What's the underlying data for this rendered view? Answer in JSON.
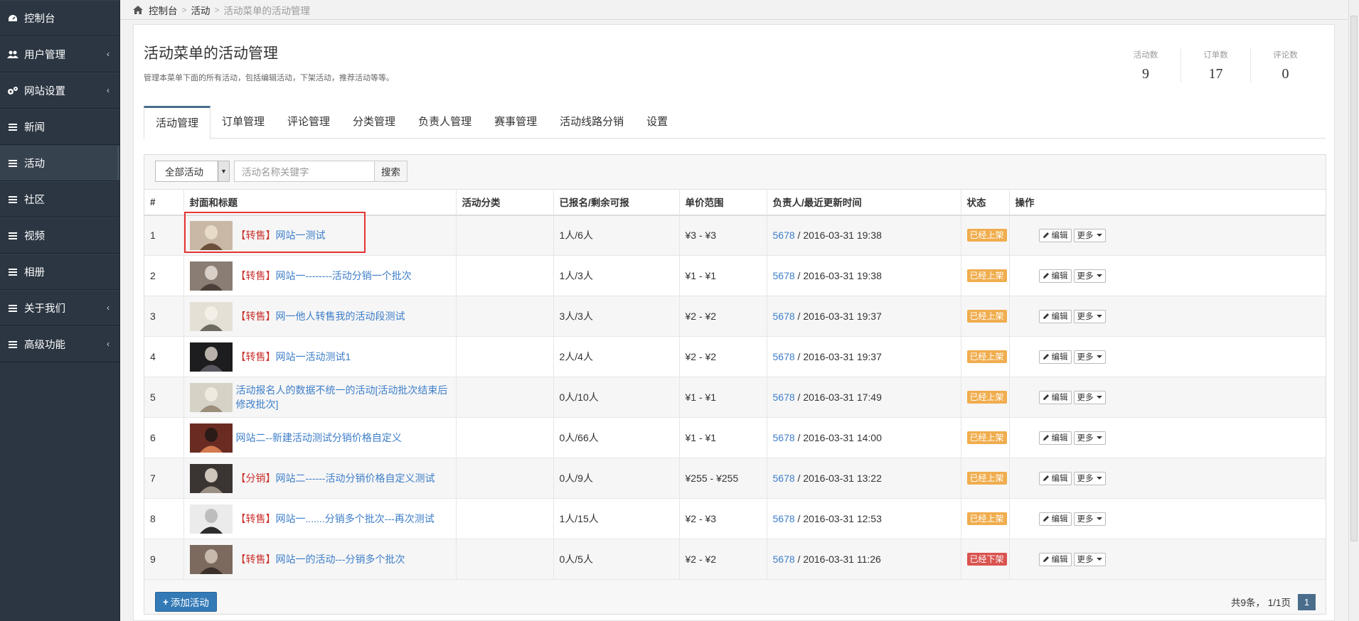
{
  "sidebar": {
    "items": [
      {
        "label": "控制台",
        "icon": "dashboard-icon",
        "has_children": false,
        "active": false
      },
      {
        "label": "用户管理",
        "icon": "users-icon",
        "has_children": true,
        "active": false
      },
      {
        "label": "网站设置",
        "icon": "cogs-icon",
        "has_children": true,
        "active": false
      },
      {
        "label": "新闻",
        "icon": "menu-icon",
        "has_children": false,
        "active": false
      },
      {
        "label": "活动",
        "icon": "menu-icon",
        "has_children": false,
        "active": true
      },
      {
        "label": "社区",
        "icon": "menu-icon",
        "has_children": false,
        "active": false
      },
      {
        "label": "视频",
        "icon": "menu-icon",
        "has_children": false,
        "active": false
      },
      {
        "label": "相册",
        "icon": "menu-icon",
        "has_children": false,
        "active": false
      },
      {
        "label": "关于我们",
        "icon": "menu-icon",
        "has_children": true,
        "active": false
      },
      {
        "label": "高级功能",
        "icon": "menu-icon",
        "has_children": true,
        "active": false
      }
    ]
  },
  "breadcrumb": [
    "控制台",
    "活动",
    "活动菜单的活动管理"
  ],
  "header": {
    "title": "活动菜单的活动管理",
    "description": "管理本菜单下面的所有活动，包括编辑活动，下架活动，推荐活动等等。"
  },
  "stats": [
    {
      "label": "活动数",
      "value": "9"
    },
    {
      "label": "订单数",
      "value": "17"
    },
    {
      "label": "评论数",
      "value": "0"
    }
  ],
  "tabs": [
    "活动管理",
    "订单管理",
    "评论管理",
    "分类管理",
    "负责人管理",
    "赛事管理",
    "活动线路分销",
    "设置"
  ],
  "toolbar": {
    "filter_value": "全部活动",
    "search_placeholder": "活动名称关键字",
    "search_label": "搜索"
  },
  "table": {
    "headers": [
      "#",
      "封面和标题",
      "活动分类",
      "已报名/剩余可报",
      "单价范围",
      "负责人/最近更新时间",
      "状态",
      "操作"
    ],
    "rows": [
      {
        "num": "1",
        "tag": "【转售】",
        "title": "网站一测试",
        "category": "",
        "signup": "1人/6人",
        "price": "¥3 - ¥3",
        "owner": "5678",
        "updated": " / 2016-03-31 19:38",
        "status": "已经上架",
        "status_type": "on"
      },
      {
        "num": "2",
        "tag": "【转售】",
        "title": "网站一--------活动分销一个批次",
        "category": "",
        "signup": "1人/3人",
        "price": "¥1 - ¥1",
        "owner": "5678",
        "updated": " / 2016-03-31 19:38",
        "status": "已经上架",
        "status_type": "on"
      },
      {
        "num": "3",
        "tag": "【转售】",
        "title": "网一他人转售我的活动段测试",
        "category": "",
        "signup": "3人/3人",
        "price": "¥2 - ¥2",
        "owner": "5678",
        "updated": " / 2016-03-31 19:37",
        "status": "已经上架",
        "status_type": "on"
      },
      {
        "num": "4",
        "tag": "【转售】",
        "title": "网站一活动测试1",
        "category": "",
        "signup": "2人/4人",
        "price": "¥2 - ¥2",
        "owner": "5678",
        "updated": " / 2016-03-31 19:37",
        "status": "已经上架",
        "status_type": "on"
      },
      {
        "num": "5",
        "tag": "",
        "title": "活动报名人的数据不统一的活动[活动批次结束后修改批次]",
        "category": "",
        "signup": "0人/10人",
        "price": "¥1 - ¥1",
        "owner": "5678",
        "updated": " / 2016-03-31 17:49",
        "status": "已经上架",
        "status_type": "on"
      },
      {
        "num": "6",
        "tag": "",
        "title": "网站二--新建活动测试分销价格自定义",
        "category": "",
        "signup": "0人/66人",
        "price": "¥1 - ¥1",
        "owner": "5678",
        "updated": " / 2016-03-31 14:00",
        "status": "已经上架",
        "status_type": "on"
      },
      {
        "num": "7",
        "tag": "【分销】",
        "title": "网站二------活动分销价格自定义测试",
        "category": "",
        "signup": "0人/9人",
        "price": "¥255 - ¥255",
        "owner": "5678",
        "updated": " / 2016-03-31 13:22",
        "status": "已经上架",
        "status_type": "on"
      },
      {
        "num": "8",
        "tag": "【转售】",
        "title": "网站一.......分销多个批次---再次测试",
        "category": "",
        "signup": "1人/15人",
        "price": "¥2 - ¥3",
        "owner": "5678",
        "updated": " / 2016-03-31 12:53",
        "status": "已经上架",
        "status_type": "on"
      },
      {
        "num": "9",
        "tag": "【转售】",
        "title": "网站一的活动---分销多个批次",
        "category": "",
        "signup": "0人/5人",
        "price": "¥2 - ¥2",
        "owner": "5678",
        "updated": " / 2016-03-31 11:26",
        "status": "已经下架",
        "status_type": "off"
      }
    ],
    "edit_label": "编辑",
    "more_label": "更多"
  },
  "footer": {
    "add_label": "添加活动",
    "pager_text": "共9条， 1/1页",
    "current_page": "1"
  },
  "colors": {
    "sidebar_bg": "#2b3642",
    "link": "#3d7ec9",
    "tag": "#c9302c",
    "status_on": "#f0ad4e",
    "status_off": "#d9534f",
    "primary": "#337ab7",
    "highlight": "#e53333"
  }
}
